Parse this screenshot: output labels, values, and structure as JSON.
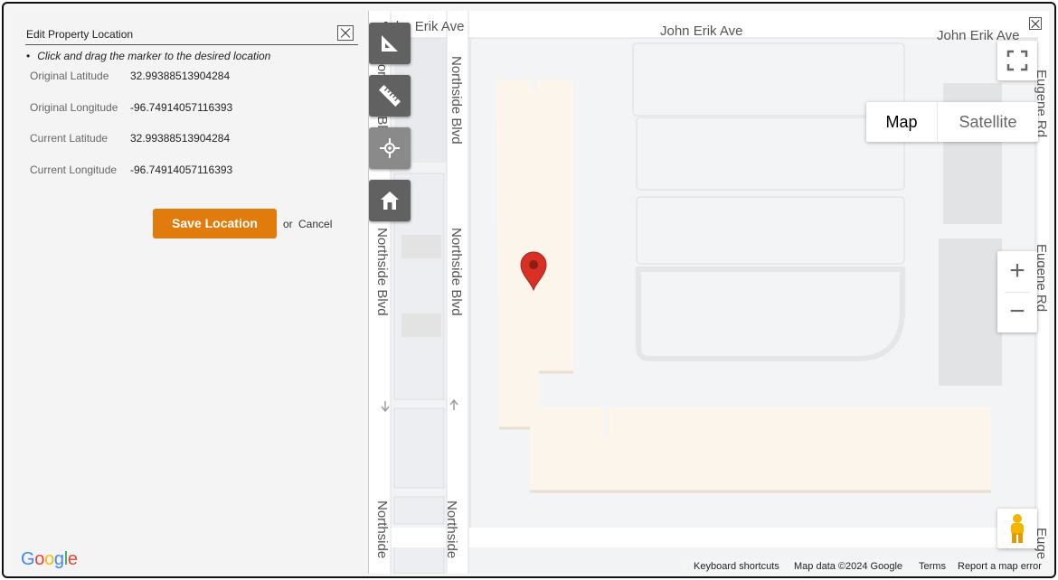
{
  "panel": {
    "title": "Edit Property Location",
    "hint": "Click and drag the marker to the desired location",
    "fields": [
      {
        "label": "Original Latitude",
        "value": "32.99388513904284"
      },
      {
        "label": "Original Longitude",
        "value": "-96.74914057116393"
      },
      {
        "label": "Current Latitude",
        "value": "32.99388513904284"
      },
      {
        "label": "Current Longitude",
        "value": "-96.74914057116393"
      }
    ],
    "save_label": "Save Location",
    "or_text": "or",
    "cancel_label": "Cancel"
  },
  "map": {
    "streets": {
      "john_erik_1": "John Erik Ave",
      "john_erik_2": "John Erik Ave",
      "john_erik_3": "John Erik Ave",
      "northside_1": "Northside Blvd",
      "northside_2": "Northside Blvd",
      "northside_3": "Northside Blvd",
      "northside_4": "Northside Blvd",
      "northside_5": "Northside",
      "northside_6": "Northside",
      "eugene_1": "Eugene Rd",
      "eugene_2": "Eugene Rd",
      "eugene_3": "Euge"
    },
    "map_type": {
      "map": "Map",
      "satellite": "Satellite",
      "selected": "Map"
    },
    "zoom_in": "+",
    "zoom_out": "−",
    "attribution": {
      "shortcuts": "Keyboard shortcuts",
      "data": "Map data ©2024 Google",
      "terms": "Terms",
      "report": "Report a map error"
    },
    "logo": "Google",
    "tools": [
      "measure-area-icon",
      "ruler-icon",
      "crosshair-icon",
      "home-icon"
    ],
    "colors": {
      "marker": "#d93025",
      "save_button": "#e07b0c",
      "tool_bg": "#616161"
    }
  }
}
